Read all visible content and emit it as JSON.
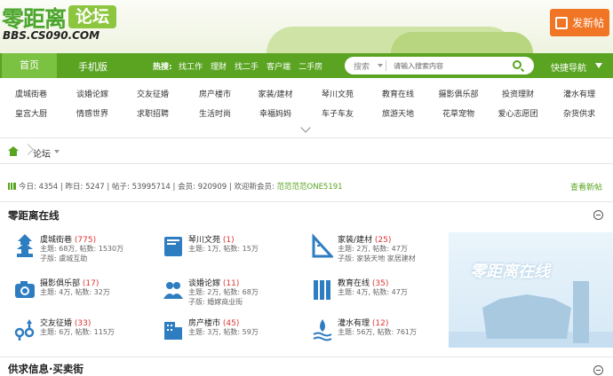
{
  "header": {
    "logo_text": "零距离",
    "logo_badge": "论坛",
    "logo_url": "BBS.CS090.COM",
    "post_button": "发新帖",
    "colors": {
      "green": "#5aa422",
      "orange": "#f07524"
    }
  },
  "nav": {
    "home": "首页",
    "mobile": "手机版",
    "hot_label": "热搜:",
    "hot_links": [
      "找工作",
      "理财",
      "找二手",
      "客户端",
      "二手房"
    ],
    "search_label": "搜索",
    "search_placeholder": "请输入搜索内容",
    "quick_nav": "快捷导航"
  },
  "categories": [
    [
      "虞城街巷",
      "谈婚论嫁",
      "交友征婚",
      "房产楼市",
      "家装/建材",
      "琴川文苑",
      "教育在线",
      "摄影俱乐部",
      "投资理财",
      "灌水有理"
    ],
    [
      "皇宫大厨",
      "情感世界",
      "求职招聘",
      "生活时尚",
      "幸福妈妈",
      "车子车友",
      "旅游天地",
      "花草宠物",
      "爱心志愿团",
      "杂货供求"
    ]
  ],
  "breadcrumb": {
    "text": "论坛"
  },
  "stats": {
    "today_label": "今日:",
    "today": "4354",
    "yesterday_label": "昨日:",
    "yesterday": "5247",
    "posts_label": "帖子:",
    "posts": "53995714",
    "members_label": "会员:",
    "members": "920909",
    "welcome_label": "欢迎新会员:",
    "new_member": "范范范范ONE5191",
    "latest_link": "查看新帖"
  },
  "section1": {
    "title": "零距离在线",
    "banner_text": "零距离在线",
    "forums": [
      {
        "name": "虞城街巷",
        "count": "(775)",
        "meta": "主题: 68万, 帖数: 1530万",
        "sub": "子版: 虞城互助",
        "icon": "pagoda-icon"
      },
      {
        "name": "琴川文苑",
        "count": "(1)",
        "meta": "主题: 1万, 帖数: 15万",
        "sub": "",
        "icon": "book-icon"
      },
      {
        "name": "家装/建材",
        "count": "(25)",
        "meta": "主题: 2万, 帖数: 47万",
        "sub": "子版: 家装天地 家居建材",
        "icon": "ruler-icon"
      },
      {
        "name": "摄影俱乐部",
        "count": "(17)",
        "meta": "主题: 4万, 帖数: 32万",
        "sub": "",
        "icon": "camera-icon"
      },
      {
        "name": "谈婚论嫁",
        "count": "(11)",
        "meta": "主题: 2万, 帖数: 68万",
        "sub": "子版: 婚嫁商业街",
        "icon": "couple-icon"
      },
      {
        "name": "教育在线",
        "count": "(35)",
        "meta": "主题: 4万, 帖数: 47万",
        "sub": "",
        "icon": "books-icon"
      },
      {
        "name": "交友征婚",
        "count": "(33)",
        "meta": "主题: 6万, 帖数: 115万",
        "sub": "",
        "icon": "gender-icon"
      },
      {
        "name": "房产楼市",
        "count": "(45)",
        "meta": "主题: 3万, 帖数: 59万",
        "sub": "",
        "icon": "building-icon"
      },
      {
        "name": "灌水有理",
        "count": "(12)",
        "meta": "主题: 56万, 帖数: 761万",
        "sub": "",
        "icon": "water-icon"
      }
    ]
  },
  "section2": {
    "title": "供求信息·买卖街"
  }
}
